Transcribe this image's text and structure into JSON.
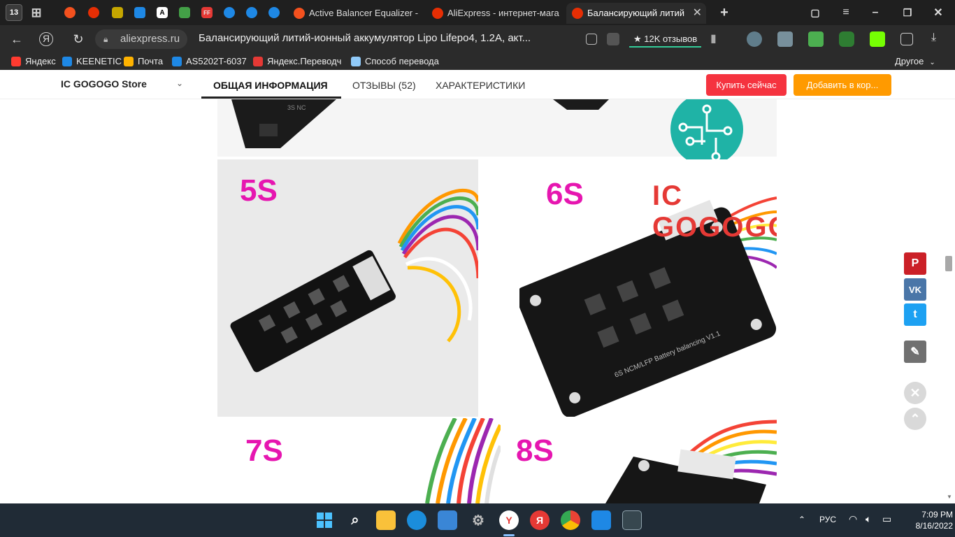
{
  "browser": {
    "tab_count": "13",
    "tabs": [
      {
        "label": "Active Balancer Equalizer -"
      },
      {
        "label": "AliExpress - интернет-мага"
      },
      {
        "label": "Балансирующий литий"
      }
    ],
    "url_host": "aliexpress.ru",
    "page_title": "Балансирующий литий-ионный аккумулятор Lipo Lifepo4, 1.2A, акт...",
    "reviews_badge": "★ 12K отзывов",
    "bookmarks": [
      {
        "label": "Яндекс",
        "icon_color": "#ff3b30"
      },
      {
        "label": "KEENETIC",
        "icon_color": "#1e88e5"
      },
      {
        "label": "Почта",
        "icon_color": "#ffb300"
      },
      {
        "label": "AS5202T-6037",
        "icon_color": "#1e88e5"
      },
      {
        "label": "Яндекс.Переводч",
        "icon_color": "#e53935"
      },
      {
        "label": "Способ перевода",
        "icon_color": "#90caf9"
      }
    ],
    "other_bookmarks": "Другое"
  },
  "store": {
    "name": "IC GOGOGO Store",
    "tabs": [
      {
        "label": "ОБЩАЯ ИНФОРМАЦИЯ",
        "active": true
      },
      {
        "label": "ОТЗЫВЫ (52)",
        "active": false
      },
      {
        "label": "ХАРАКТЕРИСТИКИ",
        "active": false
      }
    ],
    "buy_now": "Купить сейчас",
    "add_to_cart": "Добавить в кор..."
  },
  "images": {
    "labels": [
      "5S",
      "6S",
      "7S",
      "8S"
    ],
    "brand_watermark": "IC GOGOGO",
    "board_silkscreen": "6S NCM/LFP Battery balancing V1.1",
    "label_color": "#e616b0"
  },
  "social": [
    {
      "name": "pinterest",
      "glyph": "P",
      "color": "#cb2027"
    },
    {
      "name": "vk",
      "glyph": "VK",
      "color": "#4a76a8"
    },
    {
      "name": "twitter",
      "glyph": "t",
      "color": "#1da1f2"
    },
    {
      "name": "edit",
      "glyph": "✎",
      "color": "#707070"
    }
  ],
  "taskbar": {
    "language": "РУС",
    "time": "7:09 PM",
    "date": "8/16/2022"
  }
}
